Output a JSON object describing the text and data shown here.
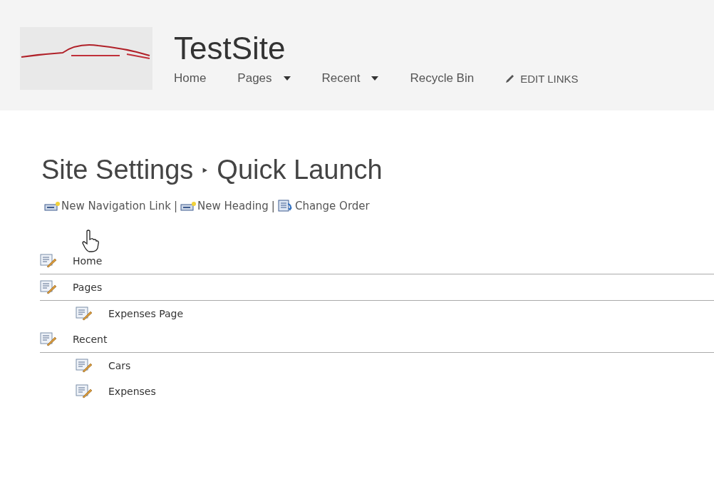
{
  "header": {
    "site_title": "TestSite",
    "nav": [
      {
        "label": "Home",
        "kind": "link"
      },
      {
        "label": "Pages",
        "kind": "menu"
      },
      {
        "label": "Recent",
        "kind": "menu"
      },
      {
        "label": "Recycle Bin",
        "kind": "link"
      },
      {
        "label": "EDIT LINKS",
        "kind": "edit"
      }
    ]
  },
  "breadcrumb": {
    "items": [
      "Site Settings",
      "Quick Launch"
    ],
    "separator": "‣"
  },
  "actions": {
    "separator": "|",
    "items": [
      {
        "label": "New Navigation Link",
        "kind": "new"
      },
      {
        "label": "New Heading",
        "kind": "new"
      },
      {
        "label": "Change Order",
        "kind": "order"
      }
    ]
  },
  "headings": [
    {
      "label": "Home"
    },
    {
      "label": "Pages",
      "children": [
        {
          "label": "Expenses Page"
        }
      ]
    },
    {
      "label": "Recent",
      "children": [
        {
          "label": "Cars"
        },
        {
          "label": "Expenses"
        }
      ]
    }
  ]
}
